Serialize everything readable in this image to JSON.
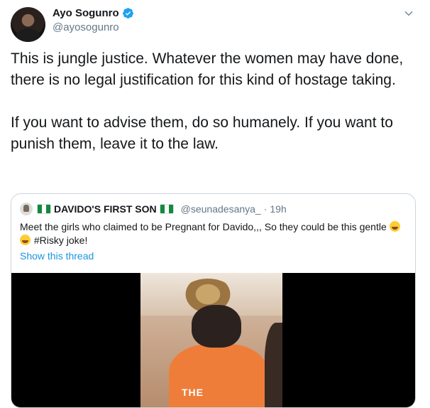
{
  "author": {
    "display_name": "Ayo Sogunro",
    "handle": "@ayosogunro",
    "verified_icon": "verified-badge-icon",
    "menu_icon": "chevron-down-icon"
  },
  "tweet": {
    "paragraph_1": "This is jungle justice. Whatever the women may have done, there is no legal justification for this kind of hostage taking.",
    "paragraph_2": "If you want to advise them, do so humanely. If you want to punish them, leave it to the law."
  },
  "quoted": {
    "display_name": "DAVIDO'S FIRST SON",
    "flag_icon": "nigeria-flag-icon",
    "handle": "@seunadesanya_",
    "separator": "·",
    "time": "19h",
    "text_part_1": "Meet the girls who claimed to be Pregnant for Davido,,, So they could be this gentle ",
    "emoji_icon": "face-with-tears-of-joy-icon",
    "text_part_2": " #Risky joke!",
    "show_thread": "Show this thread",
    "video_shirt_text": "THE"
  },
  "colors": {
    "link": "#1b95e0",
    "verified": "#1da1f2",
    "secondary_text": "#657786",
    "border": "#ccd6dd"
  }
}
